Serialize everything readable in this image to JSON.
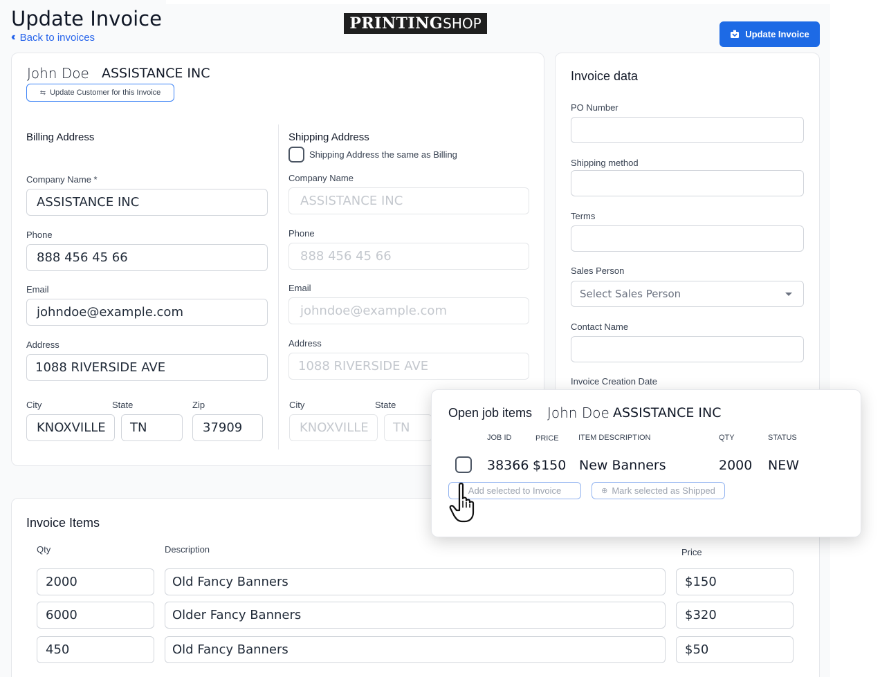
{
  "header": {
    "title": "Update Invoice",
    "back_label": "Back to invoices",
    "logo_bold": "PRINTING",
    "logo_light": "SHOP",
    "update_button": "Update Invoice"
  },
  "customer": {
    "name": "John Doe",
    "company": "ASSISTANCE INC",
    "update_button": "Update Customer for this Invoice"
  },
  "billing": {
    "heading": "Billing Address",
    "company_label": "Company Name *",
    "company_value": "ASSISTANCE INC",
    "phone_label": "Phone",
    "phone_value": "888 456 45 66",
    "email_label": "Email",
    "email_value": "johndoe@example.com",
    "address_label": "Address",
    "address_value": "1088 RIVERSIDE AVE",
    "city_label": "City",
    "city_value": "KNOXVILLE",
    "state_label": "State",
    "state_value": "TN",
    "zip_label": "Zip",
    "zip_value": "37909"
  },
  "shipping": {
    "heading": "Shipping Address",
    "same_as_billing_label": "Shipping Address the same as Billing",
    "company_label": "Company Name",
    "company_value": "ASSISTANCE INC",
    "phone_label": "Phone",
    "phone_value": "888 456 45 66",
    "email_label": "Email",
    "email_value": "johndoe@example.com",
    "address_label": "Address",
    "address_value": "1088 RIVERSIDE AVE",
    "city_label": "City",
    "city_value": "KNOXVILLE",
    "state_label": "State",
    "state_value": "TN"
  },
  "invoice_data": {
    "heading": "Invoice data",
    "po_label": "PO Number",
    "shipping_method_label": "Shipping method",
    "terms_label": "Terms",
    "sales_person_label": "Sales Person",
    "sales_person_placeholder": "Select Sales Person",
    "contact_name_label": "Contact Name",
    "creation_date_label": "Invoice Creation Date"
  },
  "open_jobs": {
    "title": "Open job items",
    "customer_name": "John Doe",
    "customer_company": "ASSISTANCE INC",
    "columns": [
      "JOB ID",
      "PRICE",
      "ITEM DESCRIPTION",
      "QTY",
      "STATUS"
    ],
    "rows": [
      {
        "job_id": "38366",
        "price": "$150",
        "description": "New Banners",
        "qty": "2000",
        "status": "NEW"
      }
    ],
    "add_button": "Add selected to Invoice",
    "ship_button": "Mark selected as Shipped"
  },
  "invoice_items": {
    "heading": "Invoice Items",
    "qty_label": "Qty",
    "description_label": "Description",
    "price_label": "Price",
    "rows": [
      {
        "qty": "2000",
        "description": "Old Fancy Banners",
        "price": "$150"
      },
      {
        "qty": "6000",
        "description": "Older Fancy Banners",
        "price": "$320"
      },
      {
        "qty": "450",
        "description": "Old Fancy Banners",
        "price": "$50"
      }
    ]
  },
  "colors": {
    "primary": "#1d6ae5",
    "link": "#2563eb",
    "border": "#d1d5db"
  }
}
